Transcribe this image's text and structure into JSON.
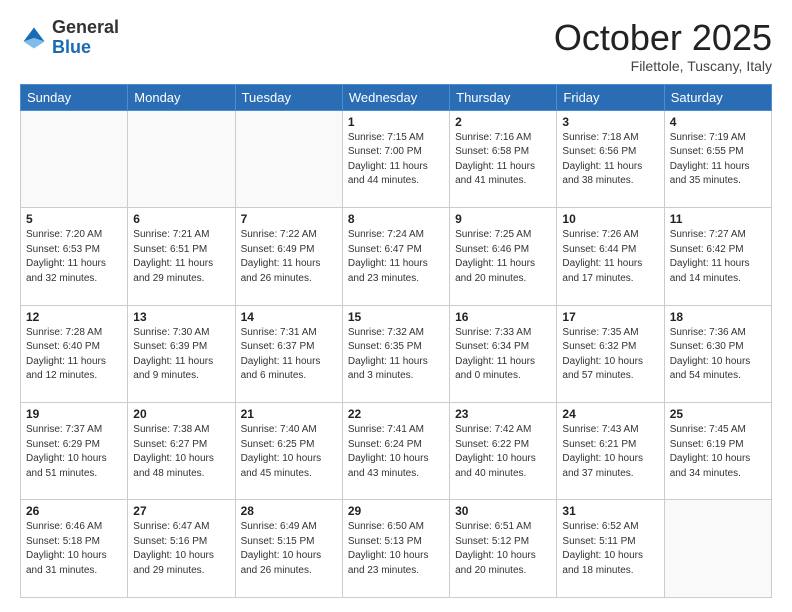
{
  "logo": {
    "general": "General",
    "blue": "Blue"
  },
  "header": {
    "month": "October 2025",
    "location": "Filettole, Tuscany, Italy"
  },
  "weekdays": [
    "Sunday",
    "Monday",
    "Tuesday",
    "Wednesday",
    "Thursday",
    "Friday",
    "Saturday"
  ],
  "weeks": [
    [
      {
        "day": "",
        "info": ""
      },
      {
        "day": "",
        "info": ""
      },
      {
        "day": "",
        "info": ""
      },
      {
        "day": "1",
        "info": "Sunrise: 7:15 AM\nSunset: 7:00 PM\nDaylight: 11 hours\nand 44 minutes."
      },
      {
        "day": "2",
        "info": "Sunrise: 7:16 AM\nSunset: 6:58 PM\nDaylight: 11 hours\nand 41 minutes."
      },
      {
        "day": "3",
        "info": "Sunrise: 7:18 AM\nSunset: 6:56 PM\nDaylight: 11 hours\nand 38 minutes."
      },
      {
        "day": "4",
        "info": "Sunrise: 7:19 AM\nSunset: 6:55 PM\nDaylight: 11 hours\nand 35 minutes."
      }
    ],
    [
      {
        "day": "5",
        "info": "Sunrise: 7:20 AM\nSunset: 6:53 PM\nDaylight: 11 hours\nand 32 minutes."
      },
      {
        "day": "6",
        "info": "Sunrise: 7:21 AM\nSunset: 6:51 PM\nDaylight: 11 hours\nand 29 minutes."
      },
      {
        "day": "7",
        "info": "Sunrise: 7:22 AM\nSunset: 6:49 PM\nDaylight: 11 hours\nand 26 minutes."
      },
      {
        "day": "8",
        "info": "Sunrise: 7:24 AM\nSunset: 6:47 PM\nDaylight: 11 hours\nand 23 minutes."
      },
      {
        "day": "9",
        "info": "Sunrise: 7:25 AM\nSunset: 6:46 PM\nDaylight: 11 hours\nand 20 minutes."
      },
      {
        "day": "10",
        "info": "Sunrise: 7:26 AM\nSunset: 6:44 PM\nDaylight: 11 hours\nand 17 minutes."
      },
      {
        "day": "11",
        "info": "Sunrise: 7:27 AM\nSunset: 6:42 PM\nDaylight: 11 hours\nand 14 minutes."
      }
    ],
    [
      {
        "day": "12",
        "info": "Sunrise: 7:28 AM\nSunset: 6:40 PM\nDaylight: 11 hours\nand 12 minutes."
      },
      {
        "day": "13",
        "info": "Sunrise: 7:30 AM\nSunset: 6:39 PM\nDaylight: 11 hours\nand 9 minutes."
      },
      {
        "day": "14",
        "info": "Sunrise: 7:31 AM\nSunset: 6:37 PM\nDaylight: 11 hours\nand 6 minutes."
      },
      {
        "day": "15",
        "info": "Sunrise: 7:32 AM\nSunset: 6:35 PM\nDaylight: 11 hours\nand 3 minutes."
      },
      {
        "day": "16",
        "info": "Sunrise: 7:33 AM\nSunset: 6:34 PM\nDaylight: 11 hours\nand 0 minutes."
      },
      {
        "day": "17",
        "info": "Sunrise: 7:35 AM\nSunset: 6:32 PM\nDaylight: 10 hours\nand 57 minutes."
      },
      {
        "day": "18",
        "info": "Sunrise: 7:36 AM\nSunset: 6:30 PM\nDaylight: 10 hours\nand 54 minutes."
      }
    ],
    [
      {
        "day": "19",
        "info": "Sunrise: 7:37 AM\nSunset: 6:29 PM\nDaylight: 10 hours\nand 51 minutes."
      },
      {
        "day": "20",
        "info": "Sunrise: 7:38 AM\nSunset: 6:27 PM\nDaylight: 10 hours\nand 48 minutes."
      },
      {
        "day": "21",
        "info": "Sunrise: 7:40 AM\nSunset: 6:25 PM\nDaylight: 10 hours\nand 45 minutes."
      },
      {
        "day": "22",
        "info": "Sunrise: 7:41 AM\nSunset: 6:24 PM\nDaylight: 10 hours\nand 43 minutes."
      },
      {
        "day": "23",
        "info": "Sunrise: 7:42 AM\nSunset: 6:22 PM\nDaylight: 10 hours\nand 40 minutes."
      },
      {
        "day": "24",
        "info": "Sunrise: 7:43 AM\nSunset: 6:21 PM\nDaylight: 10 hours\nand 37 minutes."
      },
      {
        "day": "25",
        "info": "Sunrise: 7:45 AM\nSunset: 6:19 PM\nDaylight: 10 hours\nand 34 minutes."
      }
    ],
    [
      {
        "day": "26",
        "info": "Sunrise: 6:46 AM\nSunset: 5:18 PM\nDaylight: 10 hours\nand 31 minutes."
      },
      {
        "day": "27",
        "info": "Sunrise: 6:47 AM\nSunset: 5:16 PM\nDaylight: 10 hours\nand 29 minutes."
      },
      {
        "day": "28",
        "info": "Sunrise: 6:49 AM\nSunset: 5:15 PM\nDaylight: 10 hours\nand 26 minutes."
      },
      {
        "day": "29",
        "info": "Sunrise: 6:50 AM\nSunset: 5:13 PM\nDaylight: 10 hours\nand 23 minutes."
      },
      {
        "day": "30",
        "info": "Sunrise: 6:51 AM\nSunset: 5:12 PM\nDaylight: 10 hours\nand 20 minutes."
      },
      {
        "day": "31",
        "info": "Sunrise: 6:52 AM\nSunset: 5:11 PM\nDaylight: 10 hours\nand 18 minutes."
      },
      {
        "day": "",
        "info": ""
      }
    ]
  ]
}
